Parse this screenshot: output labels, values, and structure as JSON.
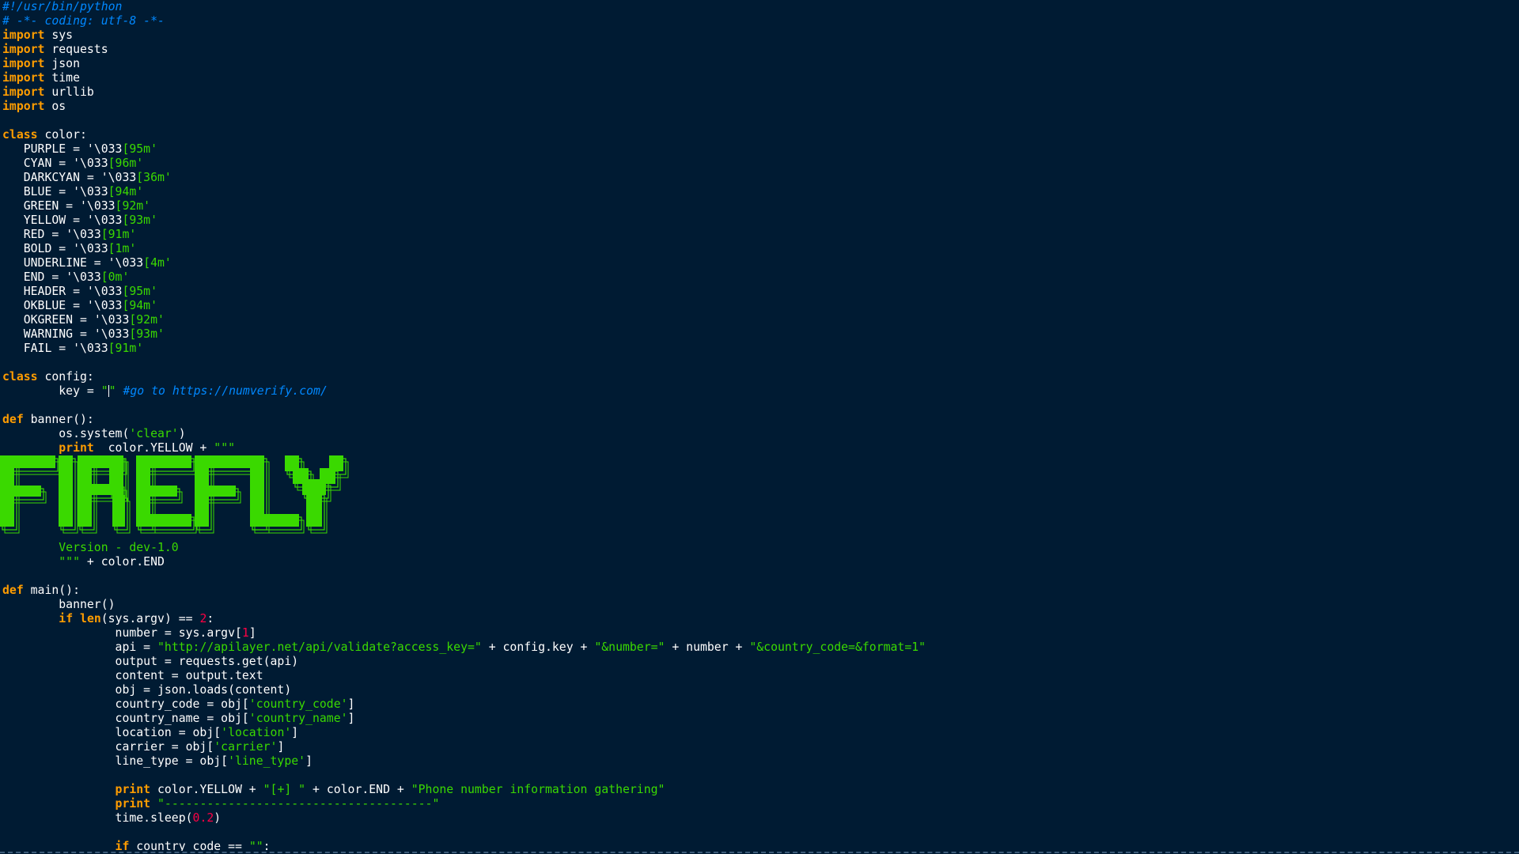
{
  "editor": {
    "background": "#001b33",
    "colors": {
      "keyword": "#ff9d00",
      "string": "#3ad900",
      "comment": "#0088ff",
      "number": "#ff0044",
      "text": "#ffffff"
    },
    "lines": [
      [
        {
          "t": "c",
          "v": "#!/usr/bin/python"
        }
      ],
      [
        {
          "t": "c",
          "v": "# -*- coding: utf-8 -*-"
        }
      ],
      [
        {
          "t": "k",
          "v": "import"
        },
        {
          "t": "p",
          "v": " sys"
        }
      ],
      [
        {
          "t": "k",
          "v": "import"
        },
        {
          "t": "p",
          "v": " requests"
        }
      ],
      [
        {
          "t": "k",
          "v": "import"
        },
        {
          "t": "p",
          "v": " json"
        }
      ],
      [
        {
          "t": "k",
          "v": "import"
        },
        {
          "t": "p",
          "v": " time"
        }
      ],
      [
        {
          "t": "k",
          "v": "import"
        },
        {
          "t": "p",
          "v": " urllib"
        }
      ],
      [
        {
          "t": "k",
          "v": "import"
        },
        {
          "t": "p",
          "v": " os"
        }
      ],
      [],
      [
        {
          "t": "k",
          "v": "class"
        },
        {
          "t": "p",
          "v": " color:"
        }
      ],
      [
        {
          "t": "p",
          "v": "   PURPLE = "
        },
        {
          "t": "p",
          "v": "'\\033"
        },
        {
          "t": "s",
          "v": "[95m'"
        }
      ],
      [
        {
          "t": "p",
          "v": "   CYAN = "
        },
        {
          "t": "p",
          "v": "'\\033"
        },
        {
          "t": "s",
          "v": "[96m'"
        }
      ],
      [
        {
          "t": "p",
          "v": "   DARKCYAN = "
        },
        {
          "t": "p",
          "v": "'\\033"
        },
        {
          "t": "s",
          "v": "[36m'"
        }
      ],
      [
        {
          "t": "p",
          "v": "   BLUE = "
        },
        {
          "t": "p",
          "v": "'\\033"
        },
        {
          "t": "s",
          "v": "[94m'"
        }
      ],
      [
        {
          "t": "p",
          "v": "   GREEN = "
        },
        {
          "t": "p",
          "v": "'\\033"
        },
        {
          "t": "s",
          "v": "[92m'"
        }
      ],
      [
        {
          "t": "p",
          "v": "   YELLOW = "
        },
        {
          "t": "p",
          "v": "'\\033"
        },
        {
          "t": "s",
          "v": "[93m'"
        }
      ],
      [
        {
          "t": "p",
          "v": "   RED = "
        },
        {
          "t": "p",
          "v": "'\\033"
        },
        {
          "t": "s",
          "v": "[91m'"
        }
      ],
      [
        {
          "t": "p",
          "v": "   BOLD = "
        },
        {
          "t": "p",
          "v": "'\\033"
        },
        {
          "t": "s",
          "v": "[1m'"
        }
      ],
      [
        {
          "t": "p",
          "v": "   UNDERLINE = "
        },
        {
          "t": "p",
          "v": "'\\033"
        },
        {
          "t": "s",
          "v": "[4m'"
        }
      ],
      [
        {
          "t": "p",
          "v": "   END = "
        },
        {
          "t": "p",
          "v": "'\\033"
        },
        {
          "t": "s",
          "v": "[0m'"
        }
      ],
      [
        {
          "t": "p",
          "v": "   HEADER = "
        },
        {
          "t": "p",
          "v": "'\\033"
        },
        {
          "t": "s",
          "v": "[95m'"
        }
      ],
      [
        {
          "t": "p",
          "v": "   OKBLUE = "
        },
        {
          "t": "p",
          "v": "'\\033"
        },
        {
          "t": "s",
          "v": "[94m'"
        }
      ],
      [
        {
          "t": "p",
          "v": "   OKGREEN = "
        },
        {
          "t": "p",
          "v": "'\\033"
        },
        {
          "t": "s",
          "v": "[92m'"
        }
      ],
      [
        {
          "t": "p",
          "v": "   WARNING = "
        },
        {
          "t": "p",
          "v": "'\\033"
        },
        {
          "t": "s",
          "v": "[93m'"
        }
      ],
      [
        {
          "t": "p",
          "v": "   FAIL = "
        },
        {
          "t": "p",
          "v": "'\\033"
        },
        {
          "t": "s",
          "v": "[91m'"
        }
      ],
      [],
      [
        {
          "t": "k",
          "v": "class"
        },
        {
          "t": "p",
          "v": " config:"
        }
      ],
      [
        {
          "t": "p",
          "v": "        key = "
        },
        {
          "t": "s",
          "v": "\""
        },
        {
          "t": "cursor",
          "v": ""
        },
        {
          "t": "s",
          "v": "\""
        },
        {
          "t": "p",
          "v": " "
        },
        {
          "t": "c",
          "v": "#go to https://numverify.com/"
        }
      ],
      [],
      [
        {
          "t": "k",
          "v": "def"
        },
        {
          "t": "p",
          "v": " banner():"
        }
      ],
      [
        {
          "t": "p",
          "v": "        os.system("
        },
        {
          "t": "s",
          "v": "'clear'"
        },
        {
          "t": "p",
          "v": ")"
        }
      ],
      [
        {
          "t": "p",
          "v": "        "
        },
        {
          "t": "k",
          "v": "print"
        },
        {
          "t": "p",
          "v": "  color.YELLOW + "
        },
        {
          "t": "s",
          "v": "\"\"\""
        }
      ],
      [],
      [],
      [],
      [],
      [],
      [],
      [
        {
          "t": "s",
          "v": "        Version - dev-1.0"
        }
      ],
      [
        {
          "t": "s",
          "v": "        \"\"\""
        },
        {
          "t": "p",
          "v": " + color.END"
        }
      ],
      [],
      [
        {
          "t": "k",
          "v": "def"
        },
        {
          "t": "p",
          "v": " main():"
        }
      ],
      [
        {
          "t": "p",
          "v": "        banner()"
        }
      ],
      [
        {
          "t": "p",
          "v": "        "
        },
        {
          "t": "k",
          "v": "if"
        },
        {
          "t": "p",
          "v": " "
        },
        {
          "t": "k",
          "v": "len"
        },
        {
          "t": "p",
          "v": "(sys.argv) == "
        },
        {
          "t": "n",
          "v": "2"
        },
        {
          "t": "p",
          "v": ":"
        }
      ],
      [
        {
          "t": "p",
          "v": "                number = sys.argv["
        },
        {
          "t": "n",
          "v": "1"
        },
        {
          "t": "p",
          "v": "]"
        }
      ],
      [
        {
          "t": "p",
          "v": "                api = "
        },
        {
          "t": "s",
          "v": "\"http://apilayer.net/api/validate?access_key=\""
        },
        {
          "t": "p",
          "v": " + config.key + "
        },
        {
          "t": "s",
          "v": "\"&number=\""
        },
        {
          "t": "p",
          "v": " + number + "
        },
        {
          "t": "s",
          "v": "\"&country_code=&format=1\""
        }
      ],
      [
        {
          "t": "p",
          "v": "                output = requests.get(api)"
        }
      ],
      [
        {
          "t": "p",
          "v": "                content = output.text"
        }
      ],
      [
        {
          "t": "p",
          "v": "                obj = json.loads(content)"
        }
      ],
      [
        {
          "t": "p",
          "v": "                country_code = obj["
        },
        {
          "t": "s",
          "v": "'country_code'"
        },
        {
          "t": "p",
          "v": "]"
        }
      ],
      [
        {
          "t": "p",
          "v": "                country_name = obj["
        },
        {
          "t": "s",
          "v": "'country_name'"
        },
        {
          "t": "p",
          "v": "]"
        }
      ],
      [
        {
          "t": "p",
          "v": "                location = obj["
        },
        {
          "t": "s",
          "v": "'location'"
        },
        {
          "t": "p",
          "v": "]"
        }
      ],
      [
        {
          "t": "p",
          "v": "                carrier = obj["
        },
        {
          "t": "s",
          "v": "'carrier'"
        },
        {
          "t": "p",
          "v": "]"
        }
      ],
      [
        {
          "t": "p",
          "v": "                line_type = obj["
        },
        {
          "t": "s",
          "v": "'line_type'"
        },
        {
          "t": "p",
          "v": "]"
        }
      ],
      [],
      [
        {
          "t": "p",
          "v": "                "
        },
        {
          "t": "k",
          "v": "print"
        },
        {
          "t": "p",
          "v": " color.YELLOW + "
        },
        {
          "t": "s",
          "v": "\"[+] \""
        },
        {
          "t": "p",
          "v": " + color.END + "
        },
        {
          "t": "s",
          "v": "\"Phone number information gathering\""
        }
      ],
      [
        {
          "t": "p",
          "v": "                "
        },
        {
          "t": "k",
          "v": "print"
        },
        {
          "t": "p",
          "v": " "
        },
        {
          "t": "s",
          "v": "\"--------------------------------------\""
        }
      ],
      [
        {
          "t": "p",
          "v": "                time.sleep("
        },
        {
          "t": "n",
          "v": "0.2"
        },
        {
          "t": "p",
          "v": ")"
        }
      ],
      [],
      [
        {
          "t": "p",
          "v": "                "
        },
        {
          "t": "k",
          "v": "if"
        },
        {
          "t": "p",
          "v": " country_code == "
        },
        {
          "t": "s",
          "v": "\"\""
        },
        {
          "t": "p",
          "v": ":"
        }
      ]
    ]
  },
  "banner": {
    "text": "FIREFLY",
    "color": "#3ad900",
    "outline": "#3ad900"
  }
}
